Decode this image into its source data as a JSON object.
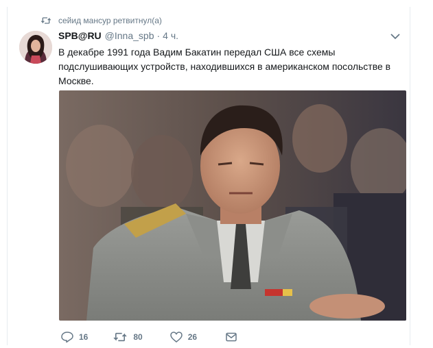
{
  "retweet": {
    "icon": "retweet-icon",
    "text": "сейид мансур ретвитнул(а)"
  },
  "tweet": {
    "fullname": "SPB@RU",
    "username": "@Inna_spb",
    "separator": "·",
    "time": "4 ч.",
    "text": "В декабре 1991 года Вадим Бакатин  передал США все схемы подслушивающих устройств, находившихся в  американском посольстве в Москве.",
    "menu_icon": "chevron-down-icon"
  },
  "actions": {
    "reply": {
      "icon": "reply-icon",
      "count": "16"
    },
    "retweet": {
      "icon": "retweet-icon",
      "count": "80"
    },
    "like": {
      "icon": "heart-icon",
      "count": "26"
    },
    "dm": {
      "icon": "envelope-icon"
    }
  },
  "colors": {
    "secondary_text": "#657786",
    "primary_text": "#14171a",
    "border": "#e6ecf0"
  }
}
